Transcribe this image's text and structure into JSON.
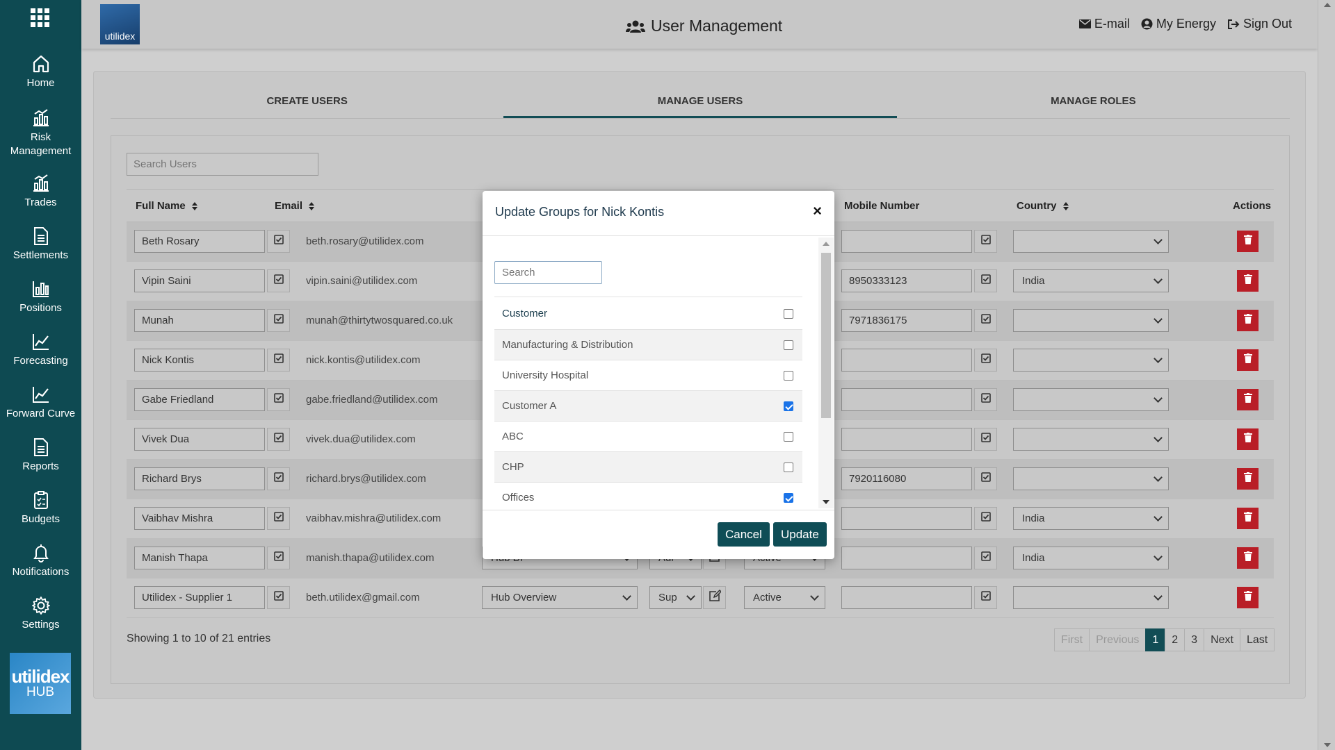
{
  "sidebar": {
    "items": [
      {
        "label": "Home",
        "icon": "home-icon"
      },
      {
        "label": "Risk Management",
        "icon": "chart-icon"
      },
      {
        "label": "Trades",
        "icon": "chart-icon"
      },
      {
        "label": "Settlements",
        "icon": "document-icon"
      },
      {
        "label": "Positions",
        "icon": "bar-chart-icon"
      },
      {
        "label": "Forecasting",
        "icon": "line-chart-icon"
      },
      {
        "label": "Forward Curve",
        "icon": "line-chart-icon"
      },
      {
        "label": "Reports",
        "icon": "document-icon"
      },
      {
        "label": "Budgets",
        "icon": "clipboard-icon"
      },
      {
        "label": "Notifications",
        "icon": "bell-icon"
      },
      {
        "label": "Settings",
        "icon": "gear-icon"
      }
    ],
    "hub_logo": {
      "line1": "utilidex",
      "line2": "HUB"
    }
  },
  "header": {
    "logo_text": "utilidex",
    "title": "User Management",
    "links": {
      "email": "E-mail",
      "my_energy": "My Energy",
      "sign_out": "Sign Out"
    }
  },
  "tabs": [
    "CREATE USERS",
    "MANAGE USERS",
    "MANAGE ROLES"
  ],
  "search": {
    "placeholder": "Search Users"
  },
  "table": {
    "columns": {
      "full_name": "Full Name",
      "email": "Email",
      "mobile": "Mobile Number",
      "country": "Country",
      "actions": "Actions"
    },
    "rows": [
      {
        "name": "Beth Rosary",
        "email": "beth.rosary@utilidex.com",
        "mobile": "",
        "country": ""
      },
      {
        "name": "Vipin Saini",
        "email": "vipin.saini@utilidex.com",
        "mobile": "8950333123",
        "country": "India"
      },
      {
        "name": "Munah",
        "email": "munah@thirtytwosquared.co.uk",
        "mobile": "7971836175",
        "country": ""
      },
      {
        "name": "Nick Kontis",
        "email": "nick.kontis@utilidex.com",
        "mobile": "",
        "country": ""
      },
      {
        "name": "Gabe Friedland",
        "email": "gabe.friedland@utilidex.com",
        "mobile": "",
        "country": ""
      },
      {
        "name": "Vivek Dua",
        "email": "vivek.dua@utilidex.com",
        "mobile": "",
        "country": ""
      },
      {
        "name": "Richard Brys",
        "email": "richard.brys@utilidex.com",
        "mobile": "7920116080",
        "country": ""
      },
      {
        "name": "Vaibhav Mishra",
        "email": "vaibhav.mishra@utilidex.com",
        "mobile": "",
        "country": "India"
      },
      {
        "name": "Manish Thapa",
        "email": "manish.thapa@utilidex.com",
        "mobile": "",
        "country": "India",
        "role": "Hub BI",
        "type": "Adr",
        "status": "Active"
      },
      {
        "name": "Utilidex - Supplier 1",
        "email": "beth.utilidex@gmail.com",
        "mobile": "",
        "country": "",
        "role": "Hub Overview",
        "type": "Sup",
        "status": "Active"
      }
    ]
  },
  "footer": {
    "showing": "Showing 1 to 10 of 21 entries",
    "pagination": [
      "First",
      "Previous",
      "1",
      "2",
      "3",
      "Next",
      "Last"
    ]
  },
  "modal": {
    "title": "Update Groups for Nick Kontis",
    "close": "×",
    "search_placeholder": "Search",
    "groups": [
      {
        "label": "Customer",
        "checked": false
      },
      {
        "label": "Manufacturing & Distribution",
        "checked": false
      },
      {
        "label": "University Hospital",
        "checked": false
      },
      {
        "label": "Customer A",
        "checked": true
      },
      {
        "label": "ABC",
        "checked": false
      },
      {
        "label": "CHP",
        "checked": false
      },
      {
        "label": "Offices",
        "checked": true
      }
    ],
    "cancel": "Cancel",
    "update": "Update"
  },
  "colors": {
    "sidebar": "#0e4a52",
    "accent": "#124d55",
    "delete": "#b91e27",
    "checkbox": "#1a73e8"
  }
}
